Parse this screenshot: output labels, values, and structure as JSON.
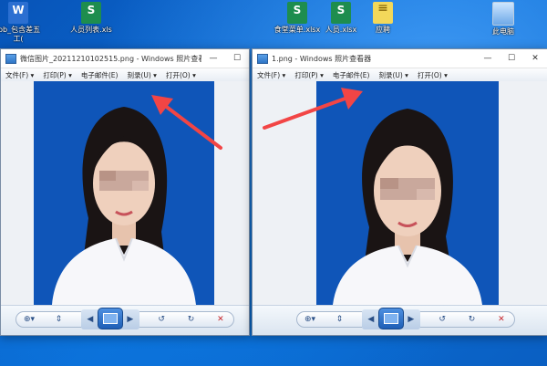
{
  "desktop": {
    "icons": [
      {
        "label": "job_包含差五工(",
        "kind": "doc"
      },
      {
        "label": "人员列表.xls",
        "kind": "xls"
      },
      {
        "label": "食堂菜单.xlsx",
        "kind": "xls"
      },
      {
        "label": "人员.xlsx",
        "kind": "xls"
      },
      {
        "label": "应聘",
        "kind": "note"
      },
      {
        "label": "此电脑",
        "kind": "pc"
      }
    ]
  },
  "windows": [
    {
      "title": "微信图片_20211210102515.png - Windows 照片查看...",
      "menu": [
        "文件(F) ▾",
        "打印(P) ▾",
        "电子邮件(E)",
        "刻录(U) ▾",
        "打开(O) ▾"
      ],
      "controls": {
        "minimize": "—",
        "maximize": "☐",
        "close": "✕"
      }
    },
    {
      "title": "1.png - Windows 照片查看器",
      "menu": [
        "文件(F) ▾",
        "打印(P) ▾",
        "电子邮件(E)",
        "刻录(U) ▾",
        "打开(O) ▾"
      ],
      "controls": {
        "minimize": "—",
        "maximize": "☐",
        "close": "✕"
      }
    }
  ],
  "toolbar_glyphs": {
    "zoom": "⊕▾",
    "fit": "⇕",
    "prev": "◀",
    "next": "▶",
    "rotate_left": "↺",
    "rotate_right": "↻",
    "delete": "✕"
  },
  "colors": {
    "photo_background": "#0f55b8",
    "arrow": "#f24545",
    "delete": "#c8262b"
  }
}
